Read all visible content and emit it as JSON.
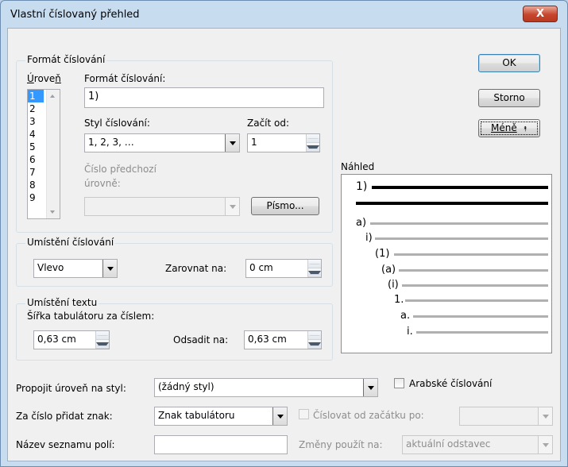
{
  "window": {
    "title": "Vlastní číslovaný přehled",
    "close_glyph": "X"
  },
  "format_group": {
    "label": "Formát číslování",
    "level_label": "Úroveň",
    "levels": [
      "1",
      "2",
      "3",
      "4",
      "5",
      "6",
      "7",
      "8",
      "9"
    ],
    "selected_level": "1",
    "format_label": "Formát číslování:",
    "format_value": "1)",
    "style_label": "Styl číslování:",
    "style_value": "1, 2, 3, …",
    "start_label": "Začít od:",
    "start_value": "1",
    "prev_level_label_1": "Číslo předchozí",
    "prev_level_label_2": "úrovně:",
    "prev_level_value": "",
    "font_button": "Písmo..."
  },
  "position_group": {
    "label": "Umístění číslování",
    "align_value": "Vlevo",
    "align_at_label": "Zarovnat na:",
    "align_at_value": "0 cm"
  },
  "text_group": {
    "label": "Umístění textu",
    "tab_width_label": "Šířka tabulátoru za číslem:",
    "tab_width_value": "0,63 cm",
    "indent_label": "Odsadit na:",
    "indent_value": "0,63 cm"
  },
  "buttons": {
    "ok": "OK",
    "cancel": "Storno",
    "less": "Méně",
    "less_glyph": "⯭"
  },
  "preview": {
    "label": "Náhled",
    "levels": [
      "1)",
      "a)",
      "i)",
      "(1)",
      "(a)",
      "(i)",
      "1.",
      "a.",
      "i."
    ]
  },
  "bottom": {
    "link_label": "Propojit úroveň na styl:",
    "link_value": "(žádný styl)",
    "legal_label": "Arabské číslování",
    "follow_label": "Za číslo přidat znak:",
    "follow_value": "Znak tabulátoru",
    "restart_label": "Číslovat od začátku po:",
    "restart_value": "",
    "field_list_label": "Název seznamu polí:",
    "field_list_value": "",
    "apply_to_label": "Změny použít na:",
    "apply_to_value": "aktuální odstavec"
  }
}
